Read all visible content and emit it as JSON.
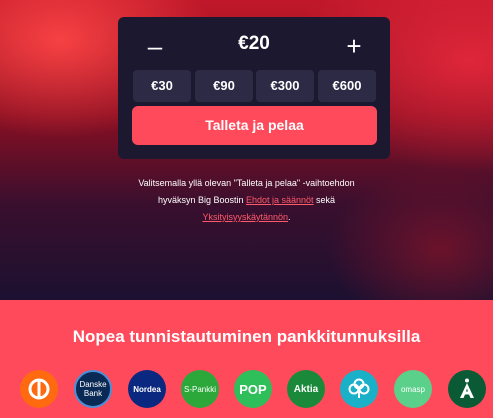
{
  "deposit": {
    "minus_label": "–",
    "plus_label": "+",
    "amount": "€20",
    "presets": [
      "€30",
      "€90",
      "€300",
      "€600"
    ],
    "cta_label": "Talleta ja pelaa"
  },
  "terms": {
    "line1": "Valitsemalla yllä olevan \"Talleta ja pelaa\" -vaihtoehdon",
    "line2_prefix": "hyväksyn Big Boostin ",
    "terms_link": "Ehdot ja säännöt",
    "line2_suffix": " sekä",
    "privacy_link": "Yksityisyyskäytännön",
    "line3_suffix": "."
  },
  "banks": {
    "title": "Nopea tunnistautuminen pankkitunnuksilla",
    "items": [
      {
        "name": "OP",
        "icon": "op-logo-icon",
        "color": "#ff6a10"
      },
      {
        "name": "Danske Bank",
        "icon": "danske-bank-logo-icon",
        "color": "#0a2a55"
      },
      {
        "name": "Nordea",
        "icon": "nordea-logo-icon",
        "color": "#0a2880"
      },
      {
        "name": "S-Pankki",
        "icon": "s-pankki-logo-icon",
        "color": "#2ca83a"
      },
      {
        "name": "POP",
        "icon": "pop-logo-icon",
        "color": "#2fbf5a"
      },
      {
        "name": "Aktia",
        "icon": "aktia-logo-icon",
        "color": "#1a8a3a"
      },
      {
        "name": "Säästöpankki",
        "icon": "saastopankki-logo-icon",
        "color": "#1ab0c8"
      },
      {
        "name": "omaSP",
        "icon": "omasp-logo-icon",
        "color": "#5ad08a"
      },
      {
        "name": "Ålandsbanken",
        "icon": "alandsbanken-logo-icon",
        "color": "#0a5a35"
      }
    ],
    "labels": {
      "danske_1": "Danske",
      "danske_2": "Bank",
      "nordea": "Nordea",
      "spankki": "S-Pankki",
      "pop": "POP",
      "aktia": "Aktia",
      "omasp": "omasp"
    }
  },
  "colors": {
    "accent": "#ff4a5b",
    "card_bg": "#1b1830",
    "preset_bg": "#2c2a45",
    "link": "#ff5a6a"
  }
}
